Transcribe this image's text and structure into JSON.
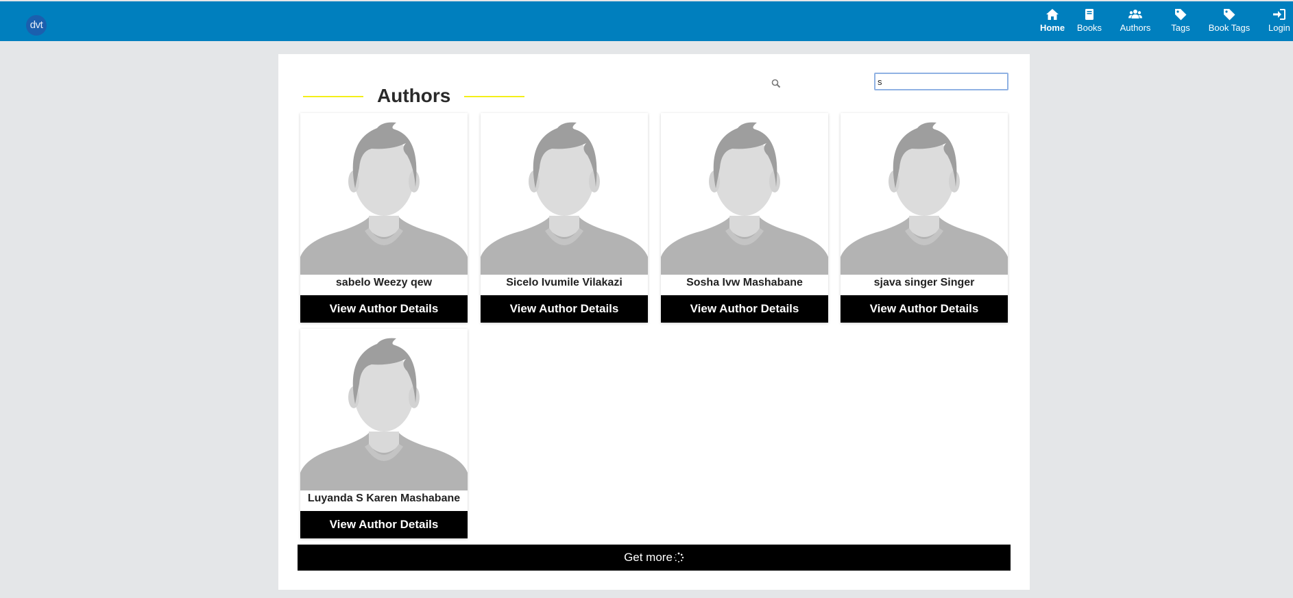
{
  "header": {
    "logo_text": "dvt",
    "brand_color": "#007fbe",
    "nav": [
      {
        "label": "Home",
        "icon": "home-icon",
        "active": true
      },
      {
        "label": "Books",
        "icon": "book-icon",
        "active": false
      },
      {
        "label": "Authors",
        "icon": "users-icon",
        "active": false
      },
      {
        "label": "Tags",
        "icon": "tag-icon",
        "active": false
      },
      {
        "label": "Book Tags",
        "icon": "tag-icon",
        "active": false
      },
      {
        "label": "Login",
        "icon": "sign-in-icon",
        "active": false
      }
    ]
  },
  "main": {
    "title": "Authors",
    "search": {
      "value": "s",
      "icon": "search-icon"
    },
    "authors": [
      {
        "name": "sabelo Weezy qew",
        "button": "View Author Details"
      },
      {
        "name": "Sicelo Ivumile Vilakazi",
        "button": "View Author Details"
      },
      {
        "name": "Sosha Ivw Mashabane",
        "button": "View Author Details"
      },
      {
        "name": "sjava singer Singer",
        "button": "View Author Details"
      },
      {
        "name": "Luyanda S Karen Mashabane",
        "button": "View Author Details"
      }
    ],
    "get_more_label": "Get more"
  }
}
